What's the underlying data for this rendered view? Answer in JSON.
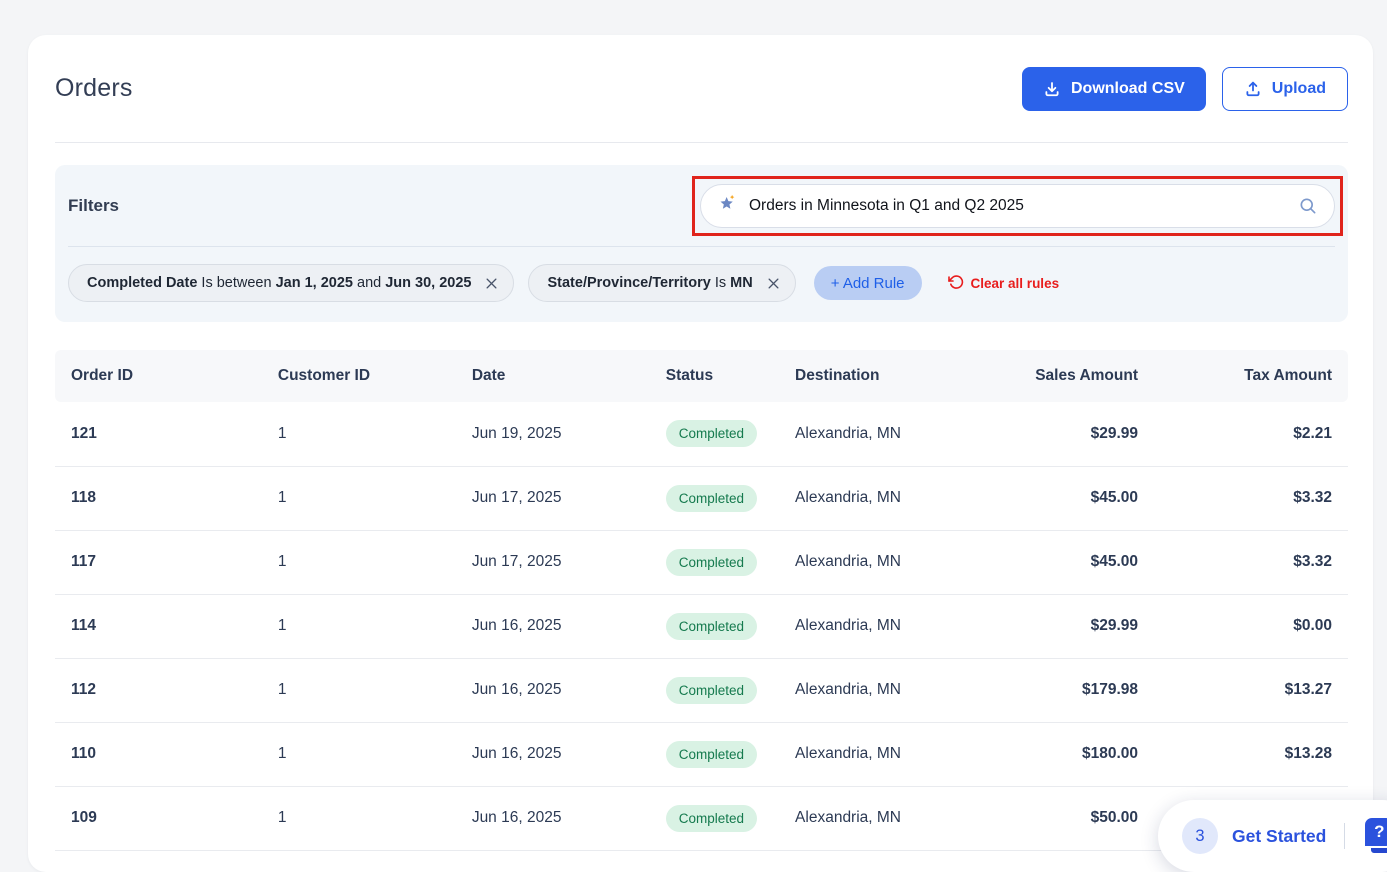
{
  "page_title": "Orders",
  "toolbar": {
    "download_csv_label": "Download CSV",
    "upload_label": "Upload"
  },
  "filters": {
    "title": "Filters",
    "search_value": "Orders in Minnesota in Q1 and Q2 2025",
    "rules": [
      {
        "segments": [
          {
            "text": "Completed Date",
            "bold": true
          },
          {
            "text": " Is between ",
            "bold": false
          },
          {
            "text": "Jan 1, 2025",
            "bold": true
          },
          {
            "text": " and ",
            "bold": false
          },
          {
            "text": "Jun 30, 2025",
            "bold": true
          }
        ]
      },
      {
        "segments": [
          {
            "text": "State/Province/Territory",
            "bold": true
          },
          {
            "text": " Is ",
            "bold": false
          },
          {
            "text": "MN",
            "bold": true
          }
        ]
      }
    ],
    "add_rule_label": "+ Add Rule",
    "clear_all_label": "Clear all rules"
  },
  "table": {
    "columns": [
      "Order ID",
      "Customer ID",
      "Date",
      "Status",
      "Destination",
      "Sales Amount",
      "Tax Amount"
    ],
    "rows": [
      {
        "order_id": "121",
        "customer_id": "1",
        "date": "Jun 19, 2025",
        "status": "Completed",
        "destination": "Alexandria, MN",
        "sales_amount": "$29.99",
        "tax_amount": "$2.21"
      },
      {
        "order_id": "118",
        "customer_id": "1",
        "date": "Jun 17, 2025",
        "status": "Completed",
        "destination": "Alexandria, MN",
        "sales_amount": "$45.00",
        "tax_amount": "$3.32"
      },
      {
        "order_id": "117",
        "customer_id": "1",
        "date": "Jun 17, 2025",
        "status": "Completed",
        "destination": "Alexandria, MN",
        "sales_amount": "$45.00",
        "tax_amount": "$3.32"
      },
      {
        "order_id": "114",
        "customer_id": "1",
        "date": "Jun 16, 2025",
        "status": "Completed",
        "destination": "Alexandria, MN",
        "sales_amount": "$29.99",
        "tax_amount": "$0.00"
      },
      {
        "order_id": "112",
        "customer_id": "1",
        "date": "Jun 16, 2025",
        "status": "Completed",
        "destination": "Alexandria, MN",
        "sales_amount": "$179.98",
        "tax_amount": "$13.27"
      },
      {
        "order_id": "110",
        "customer_id": "1",
        "date": "Jun 16, 2025",
        "status": "Completed",
        "destination": "Alexandria, MN",
        "sales_amount": "$180.00",
        "tax_amount": "$13.28"
      },
      {
        "order_id": "109",
        "customer_id": "1",
        "date": "Jun 16, 2025",
        "status": "Completed",
        "destination": "Alexandria, MN",
        "sales_amount": "$50.00",
        "tax_amount": ""
      }
    ]
  },
  "help_widget": {
    "count": "3",
    "label": "Get Started",
    "icon_question": "?"
  },
  "colors": {
    "primary_blue": "#2b62ea",
    "annotation_red": "#e0241c",
    "clear_red": "#e81d1d",
    "badge_bg": "#d9f2e4",
    "badge_text": "#157a4e",
    "get_started_blue": "#2b52dd"
  }
}
